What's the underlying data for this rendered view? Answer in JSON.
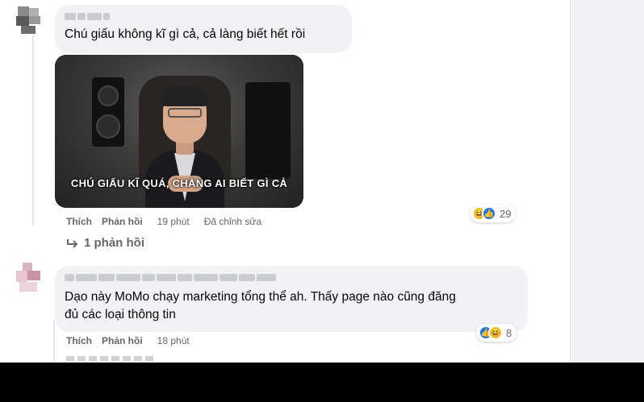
{
  "comments": [
    {
      "text": "Chú giấu không kĩ gì cả, cả làng biết hết rồi",
      "video": {
        "subtitle": "CHÚ GIẤU KĨ QUÁ, CHẲNG AI BIẾT GÌ CẢ"
      },
      "actions": {
        "like": "Thích",
        "reply": "Phản hồi",
        "time": "19 phút",
        "edited": "Đã chỉnh sửa"
      },
      "reactions": {
        "count": "29",
        "icons": [
          "haha-icon",
          "like-icon"
        ]
      },
      "replies_link": "1 phản hồi"
    },
    {
      "text_line1": "Dạo này MoMo chạy marketing tổng thể ah. Thấy page nào cũng đăng",
      "text_line2": "đủ các loại thông tin",
      "actions": {
        "like": "Thích",
        "reply": "Phản hồi",
        "time": "18 phút"
      },
      "reactions": {
        "count": "8",
        "icons": [
          "like-icon",
          "haha-icon"
        ]
      }
    }
  ],
  "colors": {
    "bubble": "#f0f2f5",
    "meta_text": "#65676b",
    "like_blue": "#1877f2",
    "haha_yellow": "#f7b928"
  }
}
